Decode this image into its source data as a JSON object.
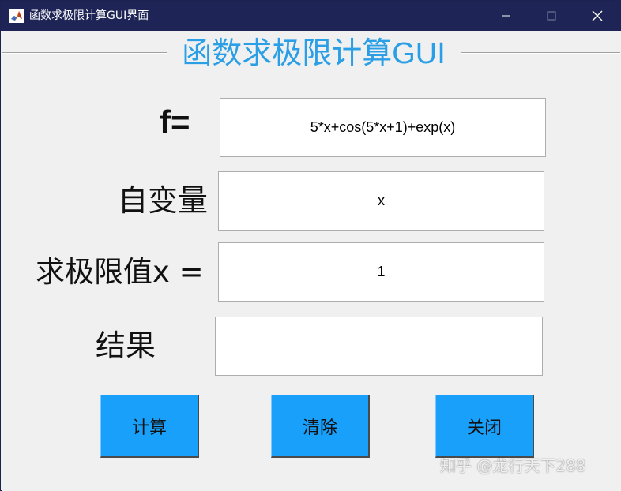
{
  "window": {
    "title": "函数求极限计算GUI界面",
    "controls": {
      "minimize": "minimize-icon",
      "maximize": "maximize-icon",
      "close": "close-icon"
    },
    "app_icon": "matlab-logo-icon"
  },
  "panel": {
    "title": "函数求极限计算GUI"
  },
  "form": {
    "function_label": "f=",
    "function_value": "5*x+cos(5*x+1)+exp(x)",
    "variable_label": "自变量",
    "variable_value": "x",
    "limit_label": "求极限值x =",
    "limit_value": "1",
    "result_label": "结果",
    "result_value": ""
  },
  "buttons": {
    "calculate": "计算",
    "clear": "清除",
    "close": "关闭"
  },
  "watermark": "知乎 @龙行天下288",
  "colors": {
    "titlebar": "#1e2456",
    "panel_title": "#2b9fe6",
    "button_bg": "#18a0fb",
    "window_bg": "#f0f0f0"
  }
}
